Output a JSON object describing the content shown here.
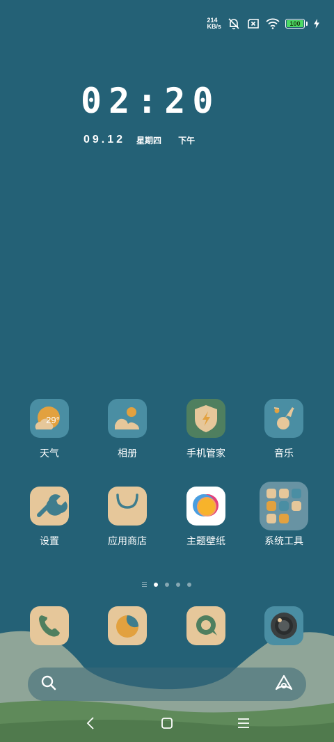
{
  "status_bar": {
    "net_speed_value": "214",
    "net_speed_unit": "KB/s",
    "icons": [
      "mute-bell-icon",
      "sim-off-icon",
      "wifi-icon",
      "charging-icon"
    ],
    "battery": "100",
    "battery_fill": 1.0,
    "battery_color": "#4cd964"
  },
  "clock": {
    "time": "02:20",
    "date": "09.12",
    "weekday": "星期四",
    "ampm": "下午"
  },
  "home": {
    "apps": [
      {
        "label": "天气",
        "icon": "weather-icon",
        "temperature": "29°"
      },
      {
        "label": "相册",
        "icon": "gallery-icon"
      },
      {
        "label": "手机管家",
        "icon": "phone-manager-icon"
      },
      {
        "label": "音乐",
        "icon": "music-icon"
      },
      {
        "label": "设置",
        "icon": "settings-wrench-icon"
      },
      {
        "label": "应用商店",
        "icon": "app-store-icon"
      },
      {
        "label": "主题壁纸",
        "icon": "theme-wallpaper-icon"
      },
      {
        "label": "系统工具",
        "icon": "folder-icon"
      }
    ],
    "page_indicator": {
      "pages": 4,
      "current": 1
    }
  },
  "dock": {
    "apps": [
      {
        "icon": "phone-icon"
      },
      {
        "icon": "browser-icon"
      },
      {
        "icon": "messages-icon"
      },
      {
        "icon": "camera-icon"
      }
    ]
  },
  "search": {
    "icons": [
      "search-icon",
      "assistant-icon"
    ]
  },
  "nav": {
    "icons": [
      "back-icon",
      "home-icon",
      "recents-icon"
    ]
  },
  "colors": {
    "background": "#246176",
    "icon_tan": "#e6c79a",
    "icon_orange": "#e2a13f",
    "icon_teal": "#4a8ea3",
    "icon_green": "#4f7f5f"
  }
}
